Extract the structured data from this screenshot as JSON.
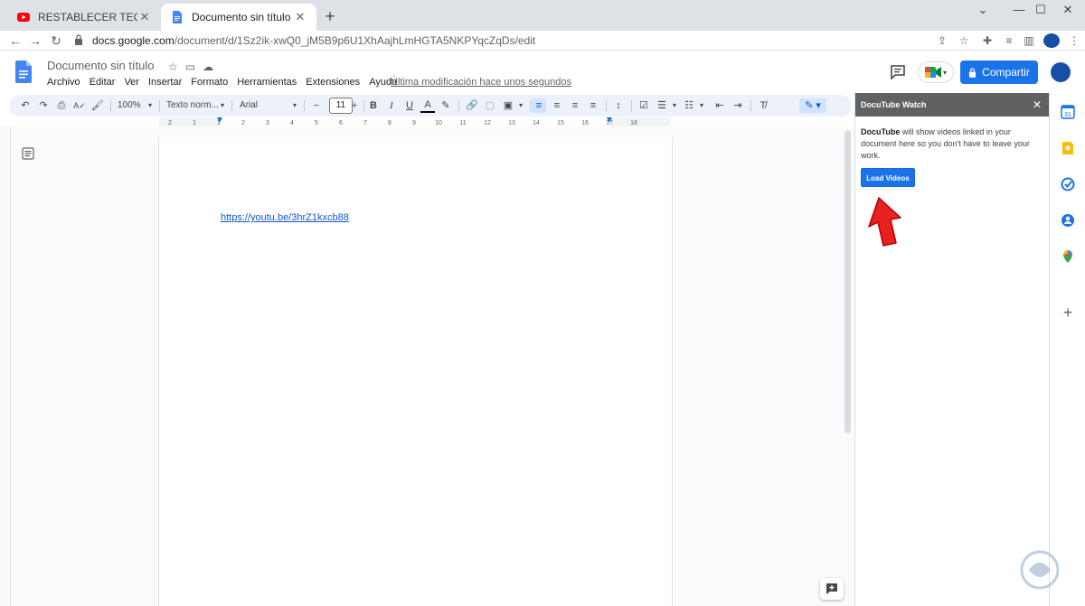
{
  "browser": {
    "tabs": [
      {
        "title": "RESTABLECER TECLADO Window",
        "active": false
      },
      {
        "title": "Documento sin título - Docum",
        "active": true
      }
    ],
    "url_host": "docs.google.com",
    "url_path": "/document/d/1Sz2ik-xwQ0_jM5B9p6U1XhAajhLmHGTA5NKPYqcZqDs/edit"
  },
  "docs": {
    "title": "Documento sin título",
    "menu": [
      "Archivo",
      "Editar",
      "Ver",
      "Insertar",
      "Formato",
      "Herramientas",
      "Extensiones",
      "Ayuda"
    ],
    "last_modified": "Última modificación hace unos segundos",
    "share_label": "Compartir"
  },
  "toolbar": {
    "zoom": "100%",
    "style": "Texto norm...",
    "font": "Arial",
    "font_size": "11"
  },
  "ruler": {
    "ticks": [
      "2",
      "1",
      "1",
      "2",
      "3",
      "4",
      "5",
      "6",
      "7",
      "8",
      "9",
      "10",
      "11",
      "12",
      "13",
      "14",
      "15",
      "16",
      "17",
      "18"
    ]
  },
  "document": {
    "link_text": "https://youtu.be/3hrZ1kxcb88"
  },
  "sidepanel": {
    "title": "DocuTube Watch",
    "description_bold": "DocuTube",
    "description_rest": " will show videos linked in your document here so you don't have to leave your work.",
    "button_label": "Load Videos"
  },
  "colors": {
    "accent": "#1a73e8",
    "panel_header": "#616161",
    "arrow": "#e8201f",
    "link": "#1155cc"
  }
}
